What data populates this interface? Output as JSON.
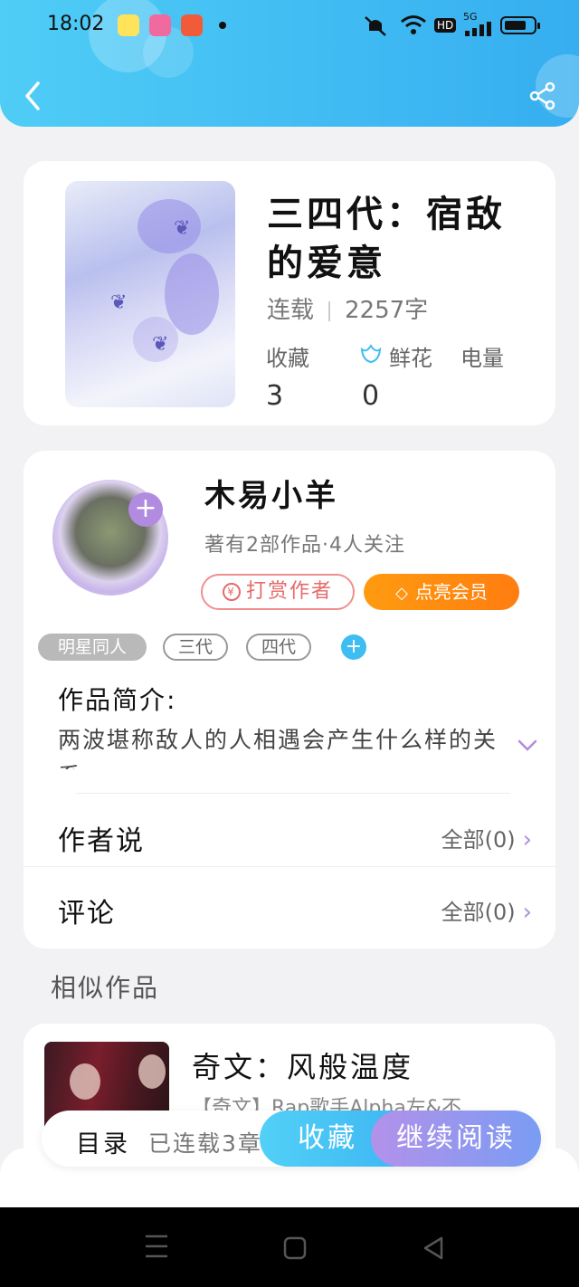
{
  "status_bar": {
    "time": "18:02",
    "network": "5G",
    "hd": "HD",
    "battery_level": 0.75
  },
  "book": {
    "title": "三四代：宿敌的爱意",
    "status": "连载",
    "word_count": "2257字",
    "stats": [
      {
        "label": "收藏",
        "value": "3"
      },
      {
        "label": "鲜花",
        "value": "0"
      },
      {
        "label": "电量",
        "value": ""
      }
    ]
  },
  "author": {
    "name": "木易小羊",
    "subtitle": "著有2部作品·4人关注",
    "reward_label": "打赏作者",
    "reward_icon": "¥",
    "vip_label": "点亮会员",
    "tags": [
      "明星同人",
      "三代",
      "四代"
    ],
    "tag_add": "+",
    "avatar_add": "+"
  },
  "intro": {
    "label": "作品简介:",
    "text": "两波堪称敌人的人相遇会产生什么样的关系"
  },
  "rows": [
    {
      "label": "作者说",
      "right": "全部(0)"
    },
    {
      "label": "评论",
      "right": "全部(0)"
    }
  ],
  "similar": {
    "title": "相似作品",
    "items": [
      {
        "title": "奇文：风般温度",
        "desc": "【奇文】Rap歌手Alpha左&不…"
      }
    ]
  },
  "bottom_bar": {
    "toc_label": "目录",
    "toc_info": "已连载3章",
    "favorite_label": "收藏",
    "continue_label": "继续阅读"
  },
  "colors": {
    "header": "#3fbdf3",
    "accent_purple": "#b18be0",
    "vip_orange": "#ff8c10",
    "reward_red": "#e66a6a"
  },
  "icons": [
    "back-arrow-icon",
    "share-icon",
    "flower-icon",
    "chevron-right-icon",
    "chevron-down-icon",
    "diamond-icon",
    "nav-menu-icon",
    "nav-home-icon",
    "nav-back-icon"
  ]
}
